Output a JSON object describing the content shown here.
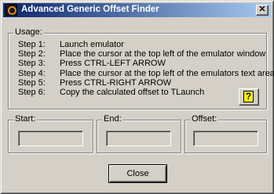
{
  "window": {
    "title": "Advanced Generic Offset Finder",
    "close_glyph": "✕"
  },
  "usage": {
    "label": "Usage:",
    "steps": [
      {
        "num": "Step 1:",
        "text": "Launch emulator"
      },
      {
        "num": "Step 2:",
        "text": "Place the cursor at the top left of the emulator window"
      },
      {
        "num": "Step 3:",
        "text": "Press CTRL-LEFT ARROW"
      },
      {
        "num": "Step 4:",
        "text": "Place the cursor at the top left of the emulators text area"
      },
      {
        "num": "Step 5:",
        "text": "Press CTRL-RIGHT ARROW"
      },
      {
        "num": "Step 6:",
        "text": "Copy the calculated offset to TLaunch"
      }
    ],
    "help_glyph": "?",
    "help_icon": "question-mark-icon"
  },
  "fields": {
    "start": {
      "label": "Start:",
      "value": ""
    },
    "end": {
      "label": "End:",
      "value": ""
    },
    "offset": {
      "label": "Offset:",
      "value": ""
    }
  },
  "close_button": {
    "label": "Close"
  },
  "colors": {
    "face": "#d4d0c8",
    "title_gradient_start": "#0a246a",
    "title_gradient_end": "#a6caf0",
    "help_icon_yellow": "#ffff00"
  }
}
